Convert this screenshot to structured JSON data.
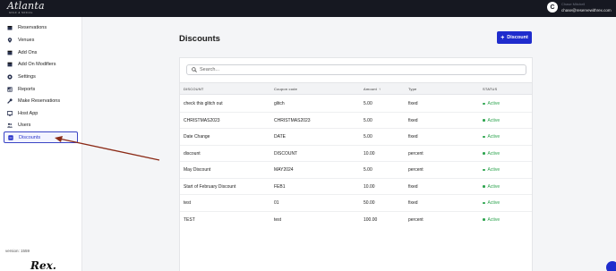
{
  "header": {
    "brand_name": "Atlanta",
    "brand_tagline": "GOLF & SOCIAL",
    "user_initial": "C",
    "user_name": "Chase Mitchell",
    "user_email": "chase@reservewithrex.com"
  },
  "sidebar": {
    "items": [
      {
        "label": "Reservations",
        "icon": "calendar-icon"
      },
      {
        "label": "Venues",
        "icon": "location-pin-icon"
      },
      {
        "label": "Add Ons",
        "icon": "box-icon"
      },
      {
        "label": "Add On Modifiers",
        "icon": "box-icon"
      },
      {
        "label": "Settings",
        "icon": "gear-icon"
      },
      {
        "label": "Reports",
        "icon": "chart-icon"
      },
      {
        "label": "Make Reservations",
        "icon": "wrench-icon"
      },
      {
        "label": "Host App",
        "icon": "monitor-icon"
      },
      {
        "label": "Users",
        "icon": "users-icon"
      },
      {
        "label": "Discounts",
        "icon": "tag-icon",
        "active": true
      }
    ],
    "version": "version: 1559",
    "bottom_logo": "Rex."
  },
  "main": {
    "title": "Discounts",
    "add_button_label": "Discount",
    "search_placeholder": "Search...",
    "columns": [
      "DISCOUNT",
      "Coupon code",
      "Amount",
      "Type",
      "STATUS"
    ],
    "sort_indicator": "↑",
    "rows": [
      {
        "name": "check this glitch out",
        "code": "glitch",
        "amount": "5.00",
        "type": "fixed",
        "status": "Active"
      },
      {
        "name": "CHRISTMAS2023",
        "code": "CHRISTMAS2023",
        "amount": "5.00",
        "type": "fixed",
        "status": "Active"
      },
      {
        "name": "Date Change",
        "code": "DATE",
        "amount": "5.00",
        "type": "fixed",
        "status": "Active"
      },
      {
        "name": "discount",
        "code": "DISCOUNT",
        "amount": "10.00",
        "type": "percent",
        "status": "Active"
      },
      {
        "name": "May Discount",
        "code": "MAY2024",
        "amount": "5.00",
        "type": "percent",
        "status": "Active"
      },
      {
        "name": "Start of February Discount",
        "code": "FEB1",
        "amount": "10.00",
        "type": "fixed",
        "status": "Active"
      },
      {
        "name": "test",
        "code": "01",
        "amount": "50.00",
        "type": "fixed",
        "status": "Active"
      },
      {
        "name": "TEST",
        "code": "test",
        "amount": "100.00",
        "type": "percent",
        "status": "Active"
      }
    ]
  },
  "colors": {
    "accent": "#1f2ccd",
    "topbar": "#161821",
    "active_status": "#2ea44f",
    "annotation_arrow": "#8b2a16"
  }
}
